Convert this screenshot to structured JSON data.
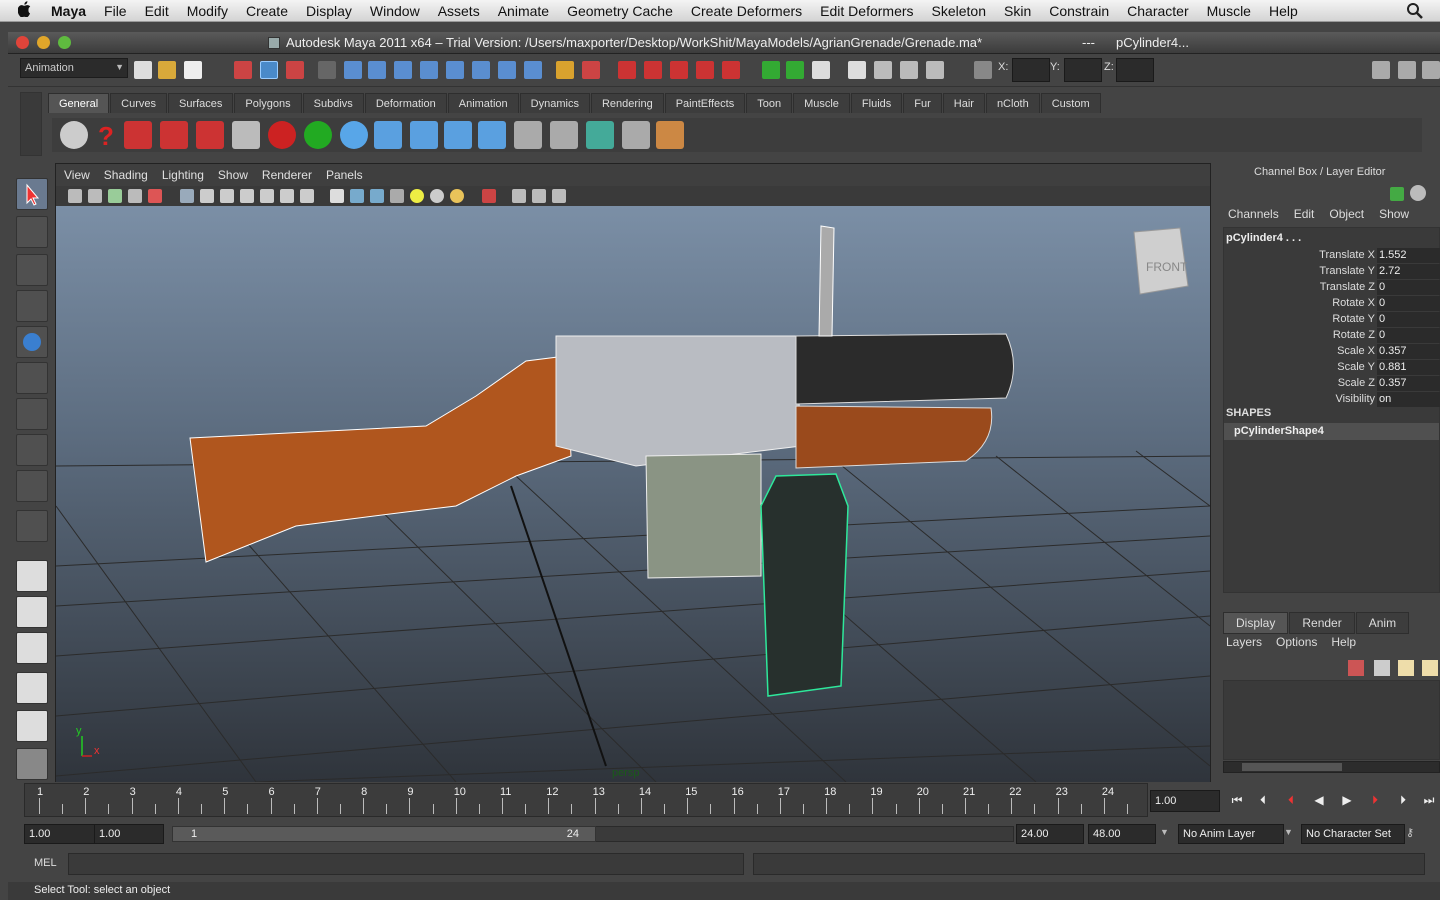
{
  "macmenu": {
    "app": "Maya",
    "items": [
      "File",
      "Edit",
      "Modify",
      "Create",
      "Display",
      "Window",
      "Assets",
      "Animate",
      "Geometry Cache",
      "Create Deformers",
      "Edit Deformers",
      "Skeleton",
      "Skin",
      "Constrain",
      "Character",
      "Muscle",
      "Help"
    ]
  },
  "window": {
    "title": "Autodesk Maya 2011 x64 – Trial Version: /Users/maxporter/Desktop/WorkShit/MayaModels/AgrianGrenade/Grenade.ma*",
    "sep": "---",
    "selection": "pCylinder4..."
  },
  "statusline": {
    "mode": "Animation",
    "x_label": "X:",
    "y_label": "Y:",
    "z_label": "Z:"
  },
  "shelf": {
    "tabs": [
      "General",
      "Curves",
      "Surfaces",
      "Polygons",
      "Subdivs",
      "Deformation",
      "Animation",
      "Dynamics",
      "Rendering",
      "PaintEffects",
      "Toon",
      "Muscle",
      "Fluids",
      "Fur",
      "Hair",
      "nCloth",
      "Custom"
    ],
    "active": "General"
  },
  "viewport": {
    "menu": [
      "View",
      "Shading",
      "Lighting",
      "Show",
      "Renderer",
      "Panels"
    ],
    "viewcube_label": "FRONT",
    "camera": "persp",
    "axis_x": "x",
    "axis_y": "y"
  },
  "channelbox": {
    "title": "Channel Box / Layer Editor",
    "menu": [
      "Channels",
      "Edit",
      "Object",
      "Show"
    ],
    "node": "pCylinder4 . . .",
    "attrs": [
      {
        "name": "Translate X",
        "value": "1.552"
      },
      {
        "name": "Translate Y",
        "value": "2.72"
      },
      {
        "name": "Translate Z",
        "value": "0"
      },
      {
        "name": "Rotate X",
        "value": "0"
      },
      {
        "name": "Rotate Y",
        "value": "0"
      },
      {
        "name": "Rotate Z",
        "value": "0"
      },
      {
        "name": "Scale X",
        "value": "0.357"
      },
      {
        "name": "Scale Y",
        "value": "0.881"
      },
      {
        "name": "Scale Z",
        "value": "0.357"
      },
      {
        "name": "Visibility",
        "value": "on"
      }
    ],
    "shapes_header": "SHAPES",
    "shape": "pCylinderShape4"
  },
  "layereditor": {
    "tabs": [
      "Display",
      "Render",
      "Anim"
    ],
    "active": "Display",
    "menu": [
      "Layers",
      "Options",
      "Help"
    ]
  },
  "timeline": {
    "ticks": [
      "1",
      "2",
      "3",
      "4",
      "5",
      "6",
      "7",
      "8",
      "9",
      "10",
      "11",
      "12",
      "13",
      "14",
      "15",
      "16",
      "17",
      "18",
      "19",
      "20",
      "21",
      "22",
      "23",
      "24"
    ],
    "current_frame": "1.00"
  },
  "range": {
    "start": "1.00",
    "playback_start": "1.00",
    "bar_start": "1",
    "bar_end": "24",
    "playback_end": "24.00",
    "end": "48.00",
    "anim_layer": "No Anim Layer",
    "character_set": "No Character Set"
  },
  "command": {
    "label": "MEL"
  },
  "helpline": "Select Tool: select an object"
}
